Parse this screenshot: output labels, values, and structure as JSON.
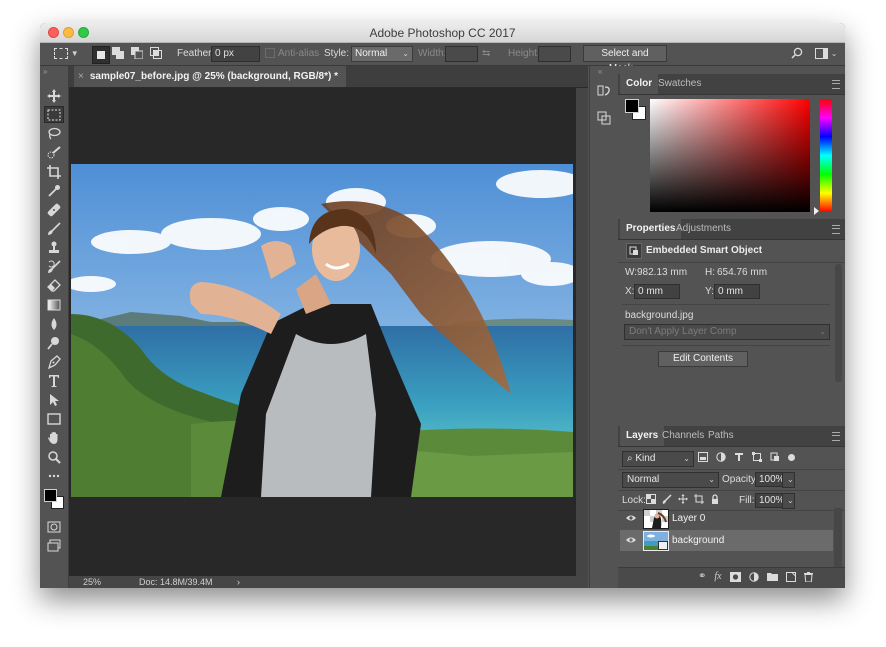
{
  "window": {
    "title": "Adobe Photoshop CC 2017"
  },
  "options_bar": {
    "feather_label": "Feather:",
    "feather_value": "0 px",
    "anti_alias_label": "Anti-alias",
    "style_label": "Style:",
    "style_value": "Normal",
    "width_label": "Width:",
    "height_label": "Height:",
    "select_mask_label": "Select and Mask..."
  },
  "document": {
    "tab_title": "sample07_before.jpg @ 25% (background, RGB/8*) *",
    "zoom": "25%",
    "doc_info": "Doc: 14.8M/39.4M"
  },
  "toolbar": {
    "tools": [
      "move-tool",
      "marquee-tool",
      "lasso-tool",
      "quick-select-tool",
      "crop-tool",
      "eyedropper-tool",
      "healing-brush-tool",
      "brush-tool",
      "clone-stamp-tool",
      "history-brush-tool",
      "eraser-tool",
      "gradient-tool",
      "blur-tool",
      "dodge-tool",
      "pen-tool",
      "type-tool",
      "path-select-tool",
      "rectangle-tool",
      "hand-tool",
      "zoom-tool",
      "more-tools"
    ],
    "foreground_color": "#000000",
    "background_color": "#ffffff"
  },
  "color_panel": {
    "tabs": [
      "Color",
      "Swatches"
    ],
    "hue_color": "#ff0000"
  },
  "properties_panel": {
    "tabs": [
      "Properties",
      "Adjustments"
    ],
    "object_type": "Embedded Smart Object",
    "w_label": "W:",
    "w_value": "982.13 mm",
    "h_label": "H:",
    "h_value": "654.76 mm",
    "x_label": "X:",
    "x_value": "0 mm",
    "y_label": "Y:",
    "y_value": "0 mm",
    "filename": "background.jpg",
    "layer_comp": "Don't Apply Layer Comp",
    "edit_contents_label": "Edit Contents"
  },
  "layers_panel": {
    "tabs": [
      "Layers",
      "Channels",
      "Paths"
    ],
    "filter_kind": "Kind",
    "blend_mode": "Normal",
    "opacity_label": "Opacity:",
    "opacity_value": "100%",
    "lock_label": "Lock:",
    "fill_label": "Fill:",
    "fill_value": "100%",
    "layers": [
      {
        "name": "Layer 0",
        "selected": false
      },
      {
        "name": "background",
        "selected": true
      }
    ]
  }
}
